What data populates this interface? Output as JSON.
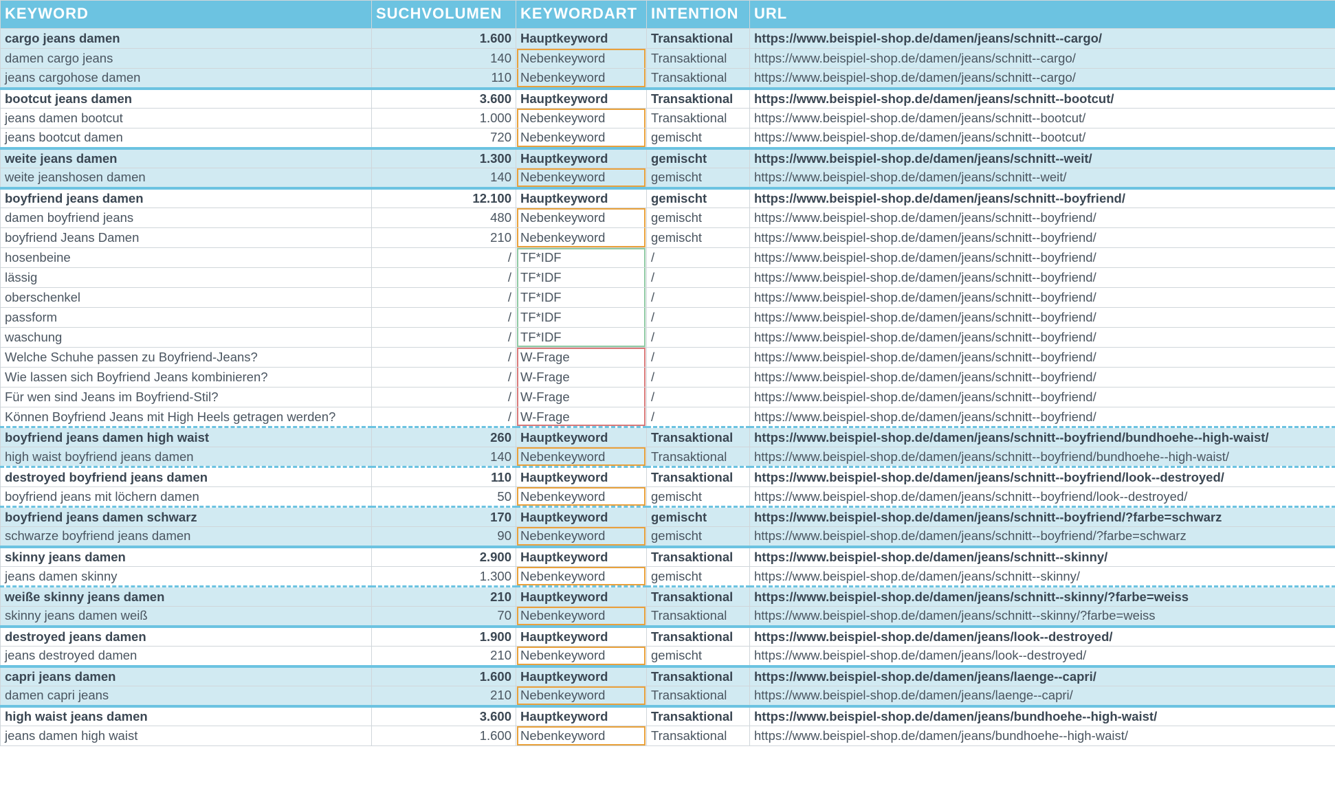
{
  "columns": {
    "keyword": "Keyword",
    "volume": "Suchvolumen",
    "art": "Keywordart",
    "intention": "Intention",
    "url": "URL"
  },
  "art_labels": {
    "haupt": "Hauptkeyword",
    "neben": "Nebenkeyword",
    "tfidf": "TF*IDF",
    "wfrage": "W-Frage"
  },
  "rows": [
    {
      "sep": "none",
      "hl": true,
      "bold": true,
      "kw": "cargo jeans damen",
      "vol": "1.600",
      "art": "haupt",
      "box": "",
      "intent": "Transaktional",
      "url": "https://www.beispiel-shop.de/damen/jeans/schnitt--cargo/"
    },
    {
      "sep": "none",
      "hl": true,
      "bold": false,
      "kw": "damen cargo jeans",
      "vol": "140",
      "art": "neben",
      "box": "orange-first",
      "intent": "Transaktional",
      "url": "https://www.beispiel-shop.de/damen/jeans/schnitt--cargo/"
    },
    {
      "sep": "none",
      "hl": true,
      "bold": false,
      "kw": "jeans cargohose damen",
      "vol": "110",
      "art": "neben",
      "box": "orange-last",
      "intent": "Transaktional",
      "url": "https://www.beispiel-shop.de/damen/jeans/schnitt--cargo/"
    },
    {
      "sep": "solid",
      "hl": false,
      "bold": true,
      "kw": "bootcut jeans damen",
      "vol": "3.600",
      "art": "haupt",
      "box": "",
      "intent": "Transaktional",
      "url": "https://www.beispiel-shop.de/damen/jeans/schnitt--bootcut/"
    },
    {
      "sep": "none",
      "hl": false,
      "bold": false,
      "kw": "jeans damen bootcut",
      "vol": "1.000",
      "art": "neben",
      "box": "orange-first",
      "intent": "Transaktional",
      "url": "https://www.beispiel-shop.de/damen/jeans/schnitt--bootcut/"
    },
    {
      "sep": "none",
      "hl": false,
      "bold": false,
      "kw": "jeans bootcut damen",
      "vol": "720",
      "art": "neben",
      "box": "orange-last",
      "intent": "gemischt",
      "url": "https://www.beispiel-shop.de/damen/jeans/schnitt--bootcut/"
    },
    {
      "sep": "solid",
      "hl": true,
      "bold": true,
      "kw": "weite jeans damen",
      "vol": "1.300",
      "art": "haupt",
      "box": "",
      "intent": "gemischt",
      "url": "https://www.beispiel-shop.de/damen/jeans/schnitt--weit/"
    },
    {
      "sep": "none",
      "hl": true,
      "bold": false,
      "kw": "weite jeanshosen damen",
      "vol": "140",
      "art": "neben",
      "box": "orange-single",
      "intent": "gemischt",
      "url": "https://www.beispiel-shop.de/damen/jeans/schnitt--weit/"
    },
    {
      "sep": "solid",
      "hl": false,
      "bold": true,
      "kw": "boyfriend jeans damen",
      "vol": "12.100",
      "art": "haupt",
      "box": "",
      "intent": "gemischt",
      "url": "https://www.beispiel-shop.de/damen/jeans/schnitt--boyfriend/"
    },
    {
      "sep": "none",
      "hl": false,
      "bold": false,
      "kw": "damen boyfriend jeans",
      "vol": "480",
      "art": "neben",
      "box": "orange-first",
      "intent": "gemischt",
      "url": "https://www.beispiel-shop.de/damen/jeans/schnitt--boyfriend/"
    },
    {
      "sep": "none",
      "hl": false,
      "bold": false,
      "kw": "boyfriend Jeans Damen",
      "vol": "210",
      "art": "neben",
      "box": "orange-last",
      "intent": "gemischt",
      "url": "https://www.beispiel-shop.de/damen/jeans/schnitt--boyfriend/"
    },
    {
      "sep": "none",
      "hl": false,
      "bold": false,
      "kw": "hosenbeine",
      "vol": "/",
      "art": "tfidf",
      "box": "green-first",
      "intent": "/",
      "url": "https://www.beispiel-shop.de/damen/jeans/schnitt--boyfriend/"
    },
    {
      "sep": "none",
      "hl": false,
      "bold": false,
      "kw": "lässig",
      "vol": "/",
      "art": "tfidf",
      "box": "green-mid",
      "intent": "/",
      "url": "https://www.beispiel-shop.de/damen/jeans/schnitt--boyfriend/"
    },
    {
      "sep": "none",
      "hl": false,
      "bold": false,
      "kw": "oberschenkel",
      "vol": "/",
      "art": "tfidf",
      "box": "green-mid",
      "intent": "/",
      "url": "https://www.beispiel-shop.de/damen/jeans/schnitt--boyfriend/"
    },
    {
      "sep": "none",
      "hl": false,
      "bold": false,
      "kw": "passform",
      "vol": "/",
      "art": "tfidf",
      "box": "green-mid",
      "intent": "/",
      "url": "https://www.beispiel-shop.de/damen/jeans/schnitt--boyfriend/"
    },
    {
      "sep": "none",
      "hl": false,
      "bold": false,
      "kw": "waschung",
      "vol": "/",
      "art": "tfidf",
      "box": "green-last",
      "intent": "/",
      "url": "https://www.beispiel-shop.de/damen/jeans/schnitt--boyfriend/"
    },
    {
      "sep": "none",
      "hl": false,
      "bold": false,
      "kw": "Welche Schuhe passen zu Boyfriend-Jeans?",
      "vol": "/",
      "art": "wfrage",
      "box": "red-first",
      "intent": "/",
      "url": "https://www.beispiel-shop.de/damen/jeans/schnitt--boyfriend/"
    },
    {
      "sep": "none",
      "hl": false,
      "bold": false,
      "kw": "Wie lassen sich Boyfriend Jeans kombinieren?",
      "vol": "/",
      "art": "wfrage",
      "box": "red-mid",
      "intent": "/",
      "url": "https://www.beispiel-shop.de/damen/jeans/schnitt--boyfriend/"
    },
    {
      "sep": "none",
      "hl": false,
      "bold": false,
      "kw": "Für wen sind Jeans im Boyfriend-Stil?",
      "vol": "/",
      "art": "wfrage",
      "box": "red-mid",
      "intent": "/",
      "url": "https://www.beispiel-shop.de/damen/jeans/schnitt--boyfriend/"
    },
    {
      "sep": "none",
      "hl": false,
      "bold": false,
      "kw": "Können Boyfriend Jeans mit High Heels getragen werden?",
      "vol": "/",
      "art": "wfrage",
      "box": "red-last",
      "intent": "/",
      "url": "https://www.beispiel-shop.de/damen/jeans/schnitt--boyfriend/"
    },
    {
      "sep": "dashed",
      "hl": true,
      "bold": true,
      "kw": "boyfriend jeans damen high waist",
      "vol": "260",
      "art": "haupt",
      "box": "",
      "intent": "Transaktional",
      "url": "https://www.beispiel-shop.de/damen/jeans/schnitt--boyfriend/bundhoehe--high-waist/"
    },
    {
      "sep": "none",
      "hl": true,
      "bold": false,
      "kw": "high waist boyfriend jeans damen",
      "vol": "140",
      "art": "neben",
      "box": "orange-single",
      "intent": "Transaktional",
      "url": "https://www.beispiel-shop.de/damen/jeans/schnitt--boyfriend/bundhoehe--high-waist/"
    },
    {
      "sep": "dashed",
      "hl": false,
      "bold": true,
      "kw": "destroyed boyfriend jeans damen",
      "vol": "110",
      "art": "haupt",
      "box": "",
      "intent": "Transaktional",
      "url": "https://www.beispiel-shop.de/damen/jeans/schnitt--boyfriend/look--destroyed/"
    },
    {
      "sep": "none",
      "hl": false,
      "bold": false,
      "kw": "boyfriend jeans mit löchern damen",
      "vol": "50",
      "art": "neben",
      "box": "orange-single",
      "intent": "gemischt",
      "url": "https://www.beispiel-shop.de/damen/jeans/schnitt--boyfriend/look--destroyed/"
    },
    {
      "sep": "dashed",
      "hl": true,
      "bold": true,
      "kw": "boyfriend jeans damen schwarz",
      "vol": "170",
      "art": "haupt",
      "box": "",
      "intent": "gemischt",
      "url": "https://www.beispiel-shop.de/damen/jeans/schnitt--boyfriend/?farbe=schwarz"
    },
    {
      "sep": "none",
      "hl": true,
      "bold": false,
      "kw": "schwarze boyfriend jeans damen",
      "vol": "90",
      "art": "neben",
      "box": "orange-single",
      "intent": "gemischt",
      "url": "https://www.beispiel-shop.de/damen/jeans/schnitt--boyfriend/?farbe=schwarz"
    },
    {
      "sep": "solid",
      "hl": false,
      "bold": true,
      "kw": "skinny jeans damen",
      "vol": "2.900",
      "art": "haupt",
      "box": "",
      "intent": "Transaktional",
      "url": "https://www.beispiel-shop.de/damen/jeans/schnitt--skinny/"
    },
    {
      "sep": "none",
      "hl": false,
      "bold": false,
      "kw": "jeans damen skinny",
      "vol": "1.300",
      "art": "neben",
      "box": "orange-single",
      "intent": "gemischt",
      "url": "https://www.beispiel-shop.de/damen/jeans/schnitt--skinny/"
    },
    {
      "sep": "dashed",
      "hl": true,
      "bold": true,
      "kw": "weiße skinny jeans damen",
      "vol": "210",
      "art": "haupt",
      "box": "",
      "intent": "Transaktional",
      "url": "https://www.beispiel-shop.de/damen/jeans/schnitt--skinny/?farbe=weiss"
    },
    {
      "sep": "none",
      "hl": true,
      "bold": false,
      "kw": "skinny jeans damen weiß",
      "vol": "70",
      "art": "neben",
      "box": "orange-single",
      "intent": "Transaktional",
      "url": "https://www.beispiel-shop.de/damen/jeans/schnitt--skinny/?farbe=weiss"
    },
    {
      "sep": "solid",
      "hl": false,
      "bold": true,
      "kw": "destroyed jeans damen",
      "vol": "1.900",
      "art": "haupt",
      "box": "",
      "intent": "Transaktional",
      "url": "https://www.beispiel-shop.de/damen/jeans/look--destroyed/"
    },
    {
      "sep": "none",
      "hl": false,
      "bold": false,
      "kw": "jeans destroyed damen",
      "vol": "210",
      "art": "neben",
      "box": "orange-single",
      "intent": "gemischt",
      "url": "https://www.beispiel-shop.de/damen/jeans/look--destroyed/"
    },
    {
      "sep": "solid",
      "hl": true,
      "bold": true,
      "kw": "capri jeans damen",
      "vol": "1.600",
      "art": "haupt",
      "box": "",
      "intent": "Transaktional",
      "url": "https://www.beispiel-shop.de/damen/jeans/laenge--capri/"
    },
    {
      "sep": "none",
      "hl": true,
      "bold": false,
      "kw": "damen capri jeans",
      "vol": "210",
      "art": "neben",
      "box": "orange-single",
      "intent": "Transaktional",
      "url": "https://www.beispiel-shop.de/damen/jeans/laenge--capri/"
    },
    {
      "sep": "solid",
      "hl": false,
      "bold": true,
      "kw": "high waist jeans damen",
      "vol": "3.600",
      "art": "haupt",
      "box": "",
      "intent": "Transaktional",
      "url": "https://www.beispiel-shop.de/damen/jeans/bundhoehe--high-waist/"
    },
    {
      "sep": "none",
      "hl": false,
      "bold": false,
      "kw": "jeans damen high waist",
      "vol": "1.600",
      "art": "neben",
      "box": "orange-single",
      "intent": "Transaktional",
      "url": "https://www.beispiel-shop.de/damen/jeans/bundhoehe--high-waist/"
    }
  ]
}
